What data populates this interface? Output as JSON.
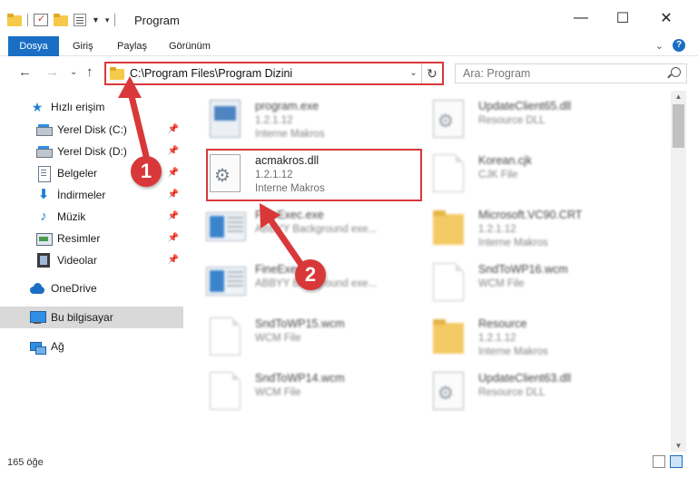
{
  "titlebar": {
    "title": "Program",
    "minimize": "—",
    "maximize": "☐",
    "close": "✕"
  },
  "ribbon": {
    "tabs": [
      "Dosya",
      "Giriş",
      "Paylaş",
      "Görünüm"
    ],
    "expand": "⌄",
    "help": "?"
  },
  "nav": {
    "back": "←",
    "forward": "→",
    "recent": "⌄",
    "up": "↑"
  },
  "address": {
    "path": "C:\\Program Files\\Program Dizini",
    "dropdown": "⌄",
    "refresh": "↻"
  },
  "search": {
    "placeholder": "Ara: Program"
  },
  "sidebar": {
    "quick_access": "Hızlı erişim",
    "items": [
      {
        "label": "Yerel Disk (C:)",
        "icon": "disk-icon",
        "pinned": true
      },
      {
        "label": "Yerel Disk (D:)",
        "icon": "disk-icon",
        "pinned": true
      },
      {
        "label": "Belgeler",
        "icon": "document-icon",
        "pinned": true
      },
      {
        "label": "İndirmeler",
        "icon": "download-icon",
        "pinned": true
      },
      {
        "label": "Müzik",
        "icon": "music-icon",
        "pinned": true
      },
      {
        "label": "Resimler",
        "icon": "pictures-icon",
        "pinned": true
      },
      {
        "label": "Videolar",
        "icon": "video-icon",
        "pinned": true
      }
    ],
    "onedrive": "OneDrive",
    "this_pc": "Bu bilgisayar",
    "network": "Ağ"
  },
  "files": {
    "left": [
      {
        "name": "program.exe",
        "line1": "1.2.1.12",
        "line2": "Interne Makros",
        "icon": "exe-icon"
      },
      {
        "name": "acmakros.dll",
        "line1": "1.2.1.12",
        "line2": "Interne Makros",
        "icon": "dll-icon"
      },
      {
        "name": "FineExec.exe",
        "line1": "ABBYY Background exe...",
        "line2": "",
        "icon": "window-icon"
      },
      {
        "name": "FineExec.exe",
        "line1": "ABBYY Background exe...",
        "line2": "",
        "icon": "window-icon"
      },
      {
        "name": "SndToWP15.wcm",
        "line1": "WCM File",
        "line2": "",
        "icon": "file-icon"
      },
      {
        "name": "SndToWP14.wcm",
        "line1": "WCM File",
        "line2": "",
        "icon": "file-icon"
      }
    ],
    "right": [
      {
        "name": "UpdateClient65.dll",
        "line1": "Resource DLL",
        "line2": "",
        "icon": "dll-icon"
      },
      {
        "name": "Korean.cjk",
        "line1": "CJK File",
        "line2": "",
        "icon": "file-icon"
      },
      {
        "name": "Microsoft.VC90.CRT",
        "line1": "1.2.1.12",
        "line2": "Interne Makros",
        "icon": "folder-icon"
      },
      {
        "name": "SndToWP16.wcm",
        "line1": "WCM File",
        "line2": "",
        "icon": "file-icon"
      },
      {
        "name": "Resource",
        "line1": "1.2.1.12",
        "line2": "Interne Makros",
        "icon": "folder-icon"
      },
      {
        "name": "UpdateClient63.dll",
        "line1": "Resource DLL",
        "line2": "",
        "icon": "dll-icon"
      }
    ]
  },
  "annotations": {
    "callout1": "1",
    "callout2": "2",
    "color": "#d9383a"
  },
  "status": {
    "count": "165 öğe"
  },
  "colors": {
    "accent": "#1a6fc4",
    "highlight": "#d9383a"
  }
}
